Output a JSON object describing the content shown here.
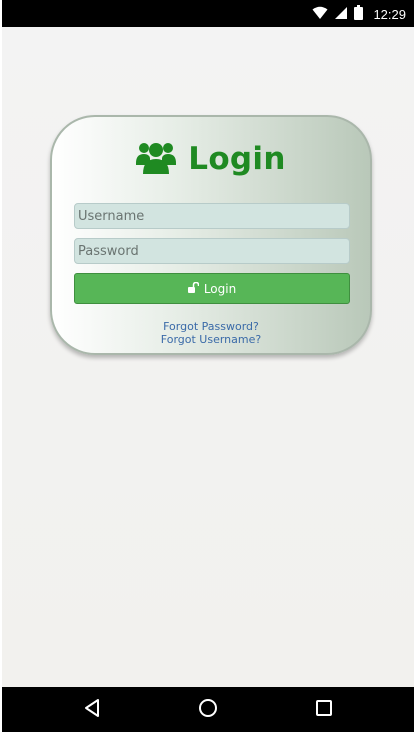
{
  "status_bar": {
    "time": "12:29",
    "icons": [
      "wifi-icon",
      "signal-icon",
      "battery-icon"
    ]
  },
  "login_card": {
    "title": "Login",
    "header_icon": "users-group-icon",
    "username_placeholder": "Username",
    "password_placeholder": "Password",
    "login_button_label": "Login",
    "login_button_icon": "unlock-icon",
    "forgot_password": "Forgot Password?",
    "forgot_username": "Forgot Username?"
  },
  "nav_bar": {
    "buttons": [
      "back-icon",
      "home-icon",
      "recents-icon"
    ]
  },
  "colors": {
    "title_green": "#1f8a22",
    "button_green": "#57b657",
    "link_blue": "#3a6aa8",
    "field_bg": "#d2e4e0"
  }
}
